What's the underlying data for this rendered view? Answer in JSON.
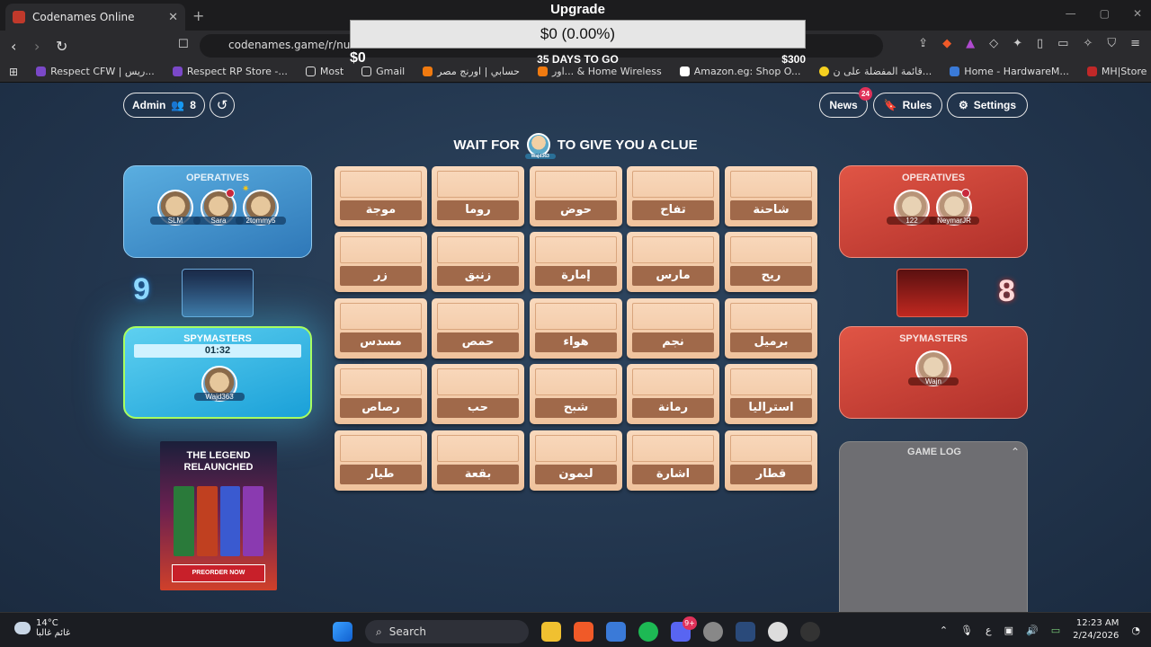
{
  "browser": {
    "tab_title": "Codenames Online",
    "url": "codenames.game/r/numo",
    "bookmarks": [
      "Respect CFW | ريس...",
      "Respect RP Store -...",
      "Most",
      "Gmail",
      "حسابي | اورنج مصر",
      "اور... & Home Wireless",
      "Amazon.eg: Shop O...",
      "قائمة المفضلة على ن...",
      "Home - HardwareM...",
      "MH|Store"
    ]
  },
  "upgrade": {
    "title": "Upgrade",
    "amount": "$0 (0.00%)",
    "left": "$0",
    "days": "35 DAYS TO GO",
    "goal": "$300"
  },
  "topbar": {
    "admin_label": "Admin",
    "player_count": "8",
    "news_label": "News",
    "news_badge": "24",
    "rules_label": "Rules",
    "settings_label": "Settings"
  },
  "clue": {
    "before": "WAIT FOR",
    "player": "Wajd363",
    "after": "TO GIVE YOU A CLUE"
  },
  "blue_team": {
    "operatives_title": "OPERATIVES",
    "operatives": [
      "SLM",
      "Sara",
      "2tommy5"
    ],
    "score": "9",
    "spymasters_title": "SPYMASTERS",
    "timer": "01:32",
    "spymaster": "Wajd363"
  },
  "red_team": {
    "operatives_title": "OPERATIVES",
    "operatives": [
      "122",
      "NeymarJR"
    ],
    "score": "8",
    "spymasters_title": "SPYMASTERS",
    "spymaster": "Wajn"
  },
  "board": {
    "words": [
      "موجة",
      "روما",
      "حوض",
      "تفاح",
      "شاحنة",
      "زر",
      "زنبق",
      "إمارة",
      "مارس",
      "ريح",
      "مسدس",
      "حمص",
      "هواء",
      "نجم",
      "برميل",
      "رصاص",
      "حب",
      "شبح",
      "رمانة",
      "استراليا",
      "طيار",
      "بقعة",
      "ليمون",
      "اشارة",
      "قطار"
    ]
  },
  "ad": {
    "title_line1": "THE LEGEND",
    "title_line2": "RELAUNCHED",
    "button": "PREORDER NOW"
  },
  "game_log": {
    "title": "GAME LOG"
  },
  "taskbar": {
    "temperature": "14°C",
    "weather_text": "غائم غالبا",
    "search_label": "Search",
    "lang": "ع",
    "time": "12:23 AM",
    "date": "2/24/2026",
    "discord_badge": "9+"
  }
}
